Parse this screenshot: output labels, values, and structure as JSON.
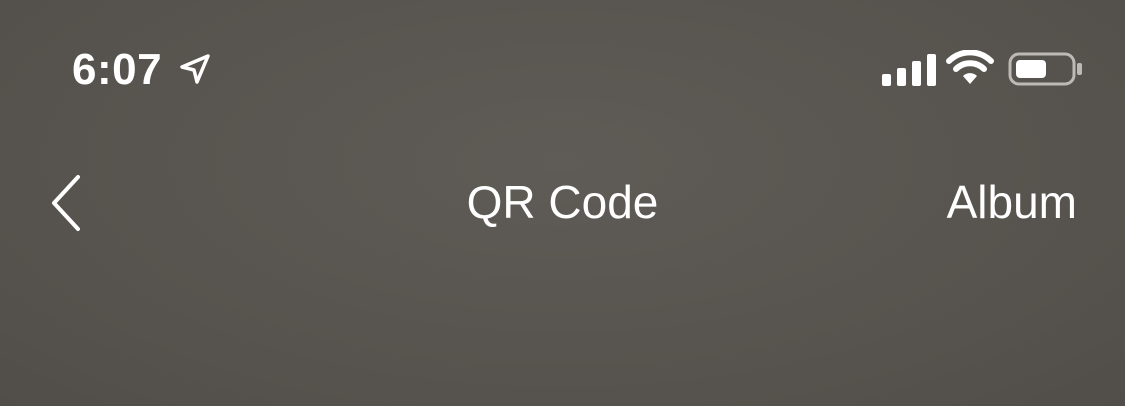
{
  "status_bar": {
    "time": "6:07",
    "location_icon": "location-arrow-icon",
    "signal_icon": "cellular-signal-icon",
    "wifi_icon": "wifi-icon",
    "battery_icon": "battery-icon",
    "battery_level": 0.5
  },
  "nav": {
    "back_icon": "chevron-left-icon",
    "title": "QR Code",
    "album_label": "Album"
  },
  "colors": {
    "background": "#5a5652",
    "foreground": "#ffffff"
  }
}
